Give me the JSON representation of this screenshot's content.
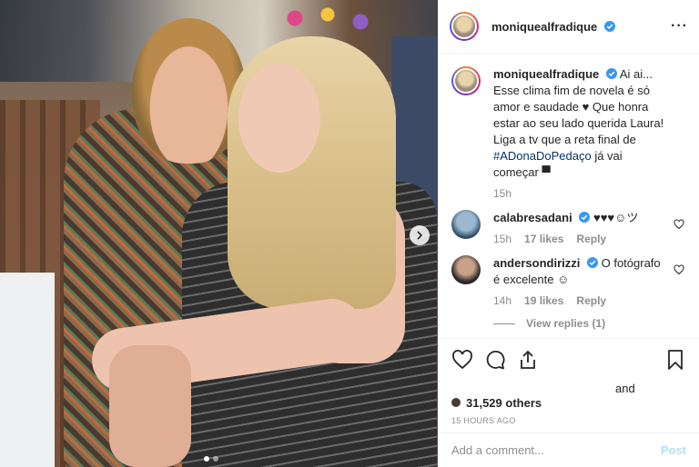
{
  "post": {
    "author": "moniquealfradique",
    "more_label": "···"
  },
  "caption": {
    "username": "moniquealfradique",
    "text_1": "Ai ai... Esse clima fim de novela é só amor e saudade",
    "emoji_1": "♥",
    "text_2": "Que honra estar ao seu lado querida Laura!",
    "text_3": "Liga a tv que a reta final de",
    "hashtag": "#ADonaDoPedaço",
    "text_4": "já vai começar",
    "emoji_2": "▀",
    "time": "15h"
  },
  "comments": [
    {
      "username": "calabresadani",
      "text": "♥♥♥☺ツ",
      "time": "15h",
      "likes": "17 likes",
      "reply": "Reply"
    },
    {
      "username": "andersondirizzi",
      "text": "O fotógrafo é excelente",
      "emoji": "☺",
      "time": "14h",
      "likes": "19 likes",
      "reply": "Reply"
    }
  ],
  "view_replies": "View replies (1)",
  "likes_prefix": "and",
  "likes_others": "31,529 others",
  "posted_time": "15 HOURS AGO",
  "add_comment": {
    "placeholder": "Add a comment...",
    "post_label": "Post"
  },
  "colors": {
    "verified": "#3897f0",
    "link": "#003569",
    "post_disabled": "#b2dffc",
    "muted": "#8e8e8e"
  }
}
